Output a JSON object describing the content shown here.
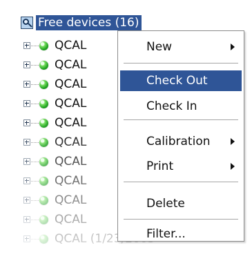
{
  "tree": {
    "root_label": "Free devices (16)",
    "rows": [
      "QCAL",
      "QCAL",
      "QCAL",
      "QCAL",
      "QCAL",
      "QCAL",
      "QCAL",
      "QCAL",
      "QCAL",
      "QCAL",
      "QCAL (1/23/2005"
    ]
  },
  "context_menu": {
    "items": [
      {
        "label": "New",
        "submenu": true
      },
      {
        "label": "Check Out",
        "submenu": false,
        "highlighted": true
      },
      {
        "label": "Check In",
        "submenu": false
      },
      {
        "label": "Calibration",
        "submenu": true
      },
      {
        "label": "Print",
        "submenu": true
      },
      {
        "label": "Delete",
        "submenu": false
      },
      {
        "label": "Filter...",
        "submenu": false
      }
    ]
  },
  "colors": {
    "selection": "#2f5597",
    "menu_border": "#8b8b8b",
    "text": "#111111"
  }
}
